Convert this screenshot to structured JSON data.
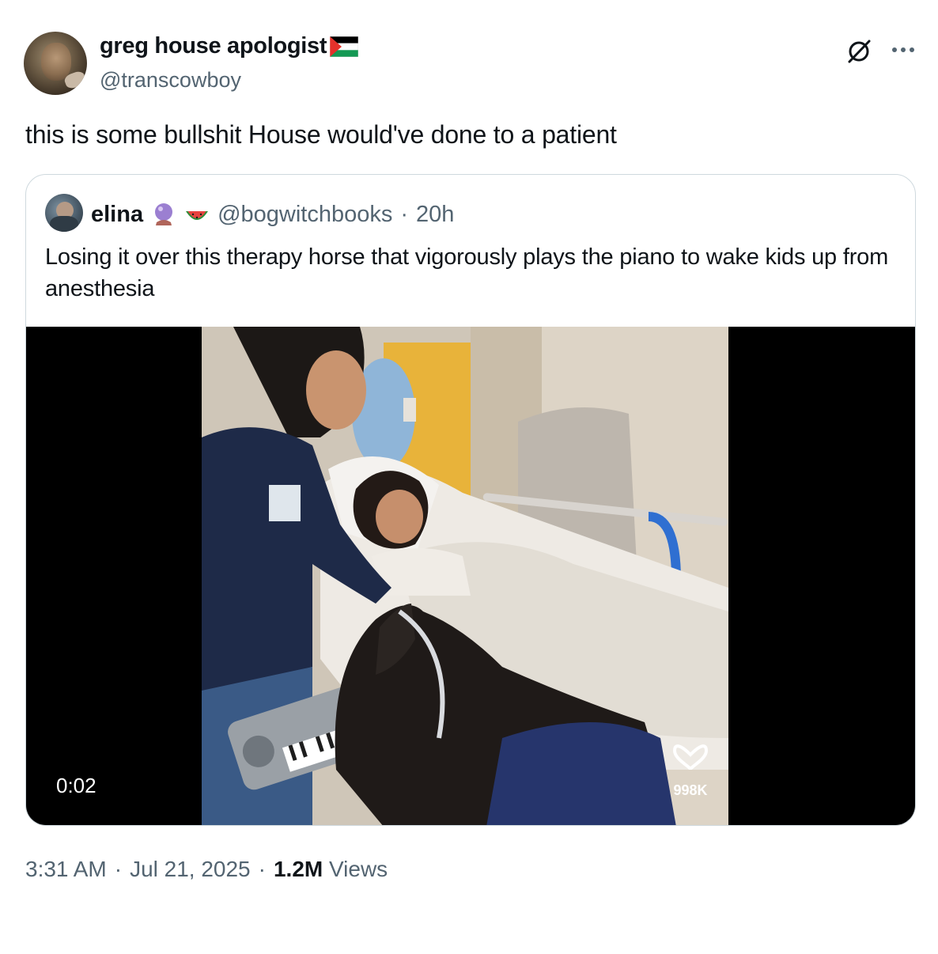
{
  "author": {
    "display_name": "greg house apologist",
    "handle": "@transcowboy"
  },
  "tweet": {
    "text": "this is some bullshit House would've done to a patient"
  },
  "quoted": {
    "display_name": "elina",
    "handle": "@bogwitchbooks",
    "separator": "·",
    "time": "20h",
    "text": "Losing it over this therapy horse that vigorously plays the piano to wake kids up from anesthesia",
    "video": {
      "timestamp": "0:02",
      "overlay_likes": "998K"
    }
  },
  "meta": {
    "time": "3:31 AM",
    "separator": "·",
    "date": "Jul 21, 2025",
    "views_count": "1.2M",
    "views_label": "Views"
  },
  "icons": [
    "palestine-flag-icon",
    "grok-icon",
    "more-icon",
    "crystal-ball-icon",
    "watermelon-icon",
    "heart-icon"
  ]
}
